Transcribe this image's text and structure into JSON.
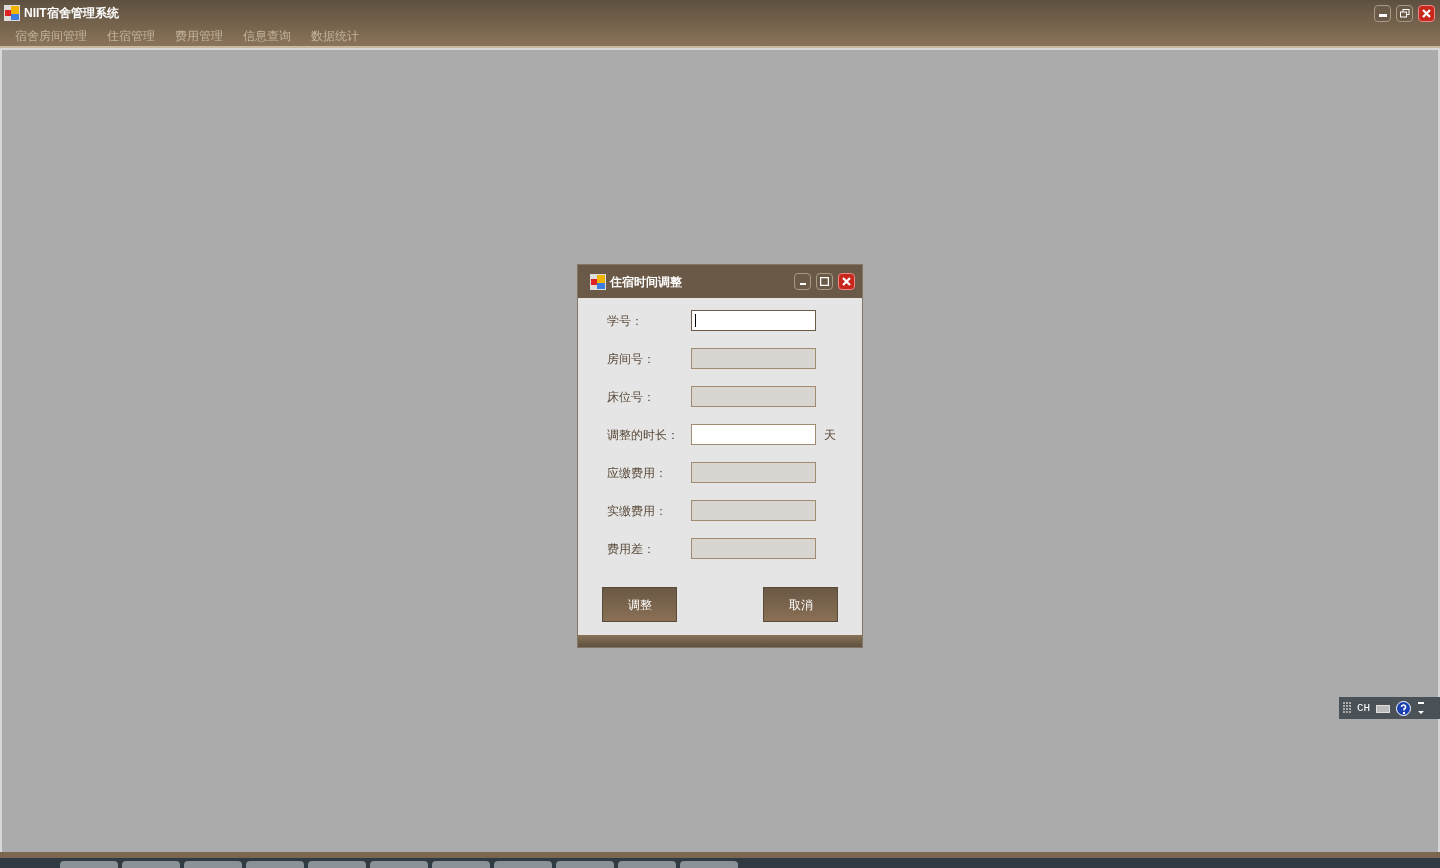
{
  "window": {
    "title": "NIIT宿舍管理系统"
  },
  "menu": [
    "宿舍房间管理",
    "住宿管理",
    "费用管理",
    "信息查询",
    "数据统计"
  ],
  "dialog": {
    "title": "住宿时间调整",
    "fields": [
      {
        "label": "学号：",
        "readonly": false,
        "focused": true
      },
      {
        "label": "房间号：",
        "readonly": true,
        "focused": false
      },
      {
        "label": "床位号：",
        "readonly": true,
        "focused": false
      },
      {
        "label": "调整的时长：",
        "readonly": false,
        "focused": false,
        "unit": "天"
      },
      {
        "label": "应缴费用：",
        "readonly": true,
        "focused": false
      },
      {
        "label": "实缴费用：",
        "readonly": true,
        "focused": false
      },
      {
        "label": "费用差：",
        "readonly": true,
        "focused": false
      }
    ],
    "buttons": [
      "调整",
      "取消"
    ]
  },
  "language_bar": {
    "language": "CH"
  }
}
